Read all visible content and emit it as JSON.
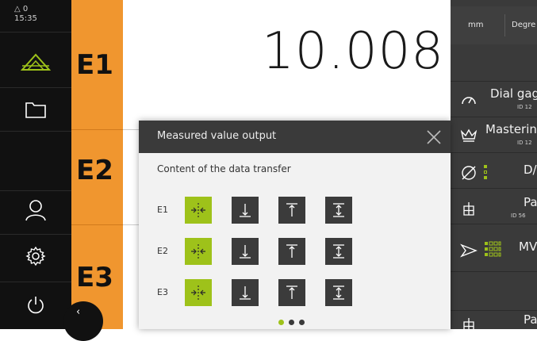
{
  "status": {
    "alerts": "△ 0",
    "time": "15:35"
  },
  "sidebar": {
    "items": [
      {
        "icon": "measure-icon",
        "active": true
      },
      {
        "icon": "folder-icon"
      },
      {
        "icon": "user-icon"
      },
      {
        "icon": "settings-icon"
      },
      {
        "icon": "power-icon"
      }
    ],
    "collapse_label": "‹"
  },
  "axes": [
    "E1",
    "E2",
    "E3"
  ],
  "measurement": {
    "value": "10.008"
  },
  "units": {
    "length": "mm",
    "angle": "Degre"
  },
  "right_panel": {
    "items": [
      {
        "title": "Dial gag",
        "sub": "ID 12",
        "icon": "dial-gauge-icon"
      },
      {
        "title": "Masterin",
        "sub": "ID 12",
        "icon": "crown-icon"
      },
      {
        "title": "D/",
        "sub": "",
        "icon": "diameter-icon"
      },
      {
        "title": "Pa",
        "sub": "ID 56",
        "icon": "grid-icon"
      },
      {
        "title": "MV",
        "sub": "",
        "icon": "send-icon"
      },
      {
        "title": "Pa",
        "sub": "",
        "icon": "grid-icon"
      }
    ]
  },
  "modal": {
    "title": "Measured value output",
    "subtitle": "Content of the data transfer",
    "rows": [
      {
        "label": "E1",
        "selected": 0
      },
      {
        "label": "E2",
        "selected": 0
      },
      {
        "label": "E3",
        "selected": 0
      }
    ],
    "options": [
      "current-value-icon",
      "min-value-icon",
      "max-value-icon",
      "range-icon"
    ],
    "page": 1,
    "pages": 3
  },
  "colors": {
    "accent_orange": "#f0962f",
    "accent_green": "#9ec21a",
    "dark": "#111111",
    "panel": "#3a3a3a"
  }
}
